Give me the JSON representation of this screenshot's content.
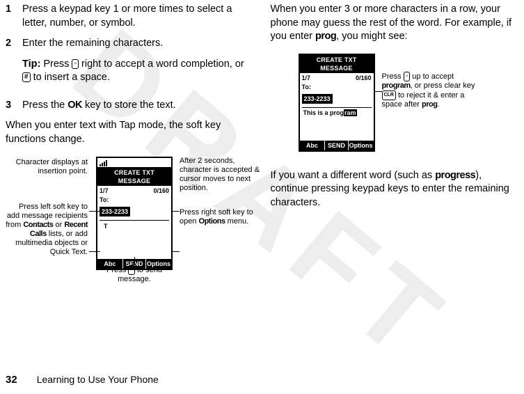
{
  "watermark": "DRAFT",
  "left_column": {
    "steps": [
      {
        "num": "1",
        "body": "Press a keypad key 1 or more times to select a letter, number, or symbol."
      },
      {
        "num": "2",
        "body": "Enter the remaining characters."
      },
      {
        "num": "3",
        "body_prefix": "Press the ",
        "body_key": "OK",
        "body_suffix": " key to store the text."
      }
    ],
    "tip_label": "Tip:",
    "tip_prefix": " Press ",
    "tip_mid": " right to accept a word completion, or ",
    "tip_hash": "#",
    "tip_suffix": " to insert a space.",
    "soft_key_para": "When you enter text with Tap mode, the soft key functions change."
  },
  "diagram1": {
    "title": "CREATE TXT MESSAGE",
    "page": "1/7",
    "count": "0/160",
    "to": "To:",
    "number": "233-2233",
    "text_char": "T",
    "soft_left": "Abc",
    "soft_mid": "SEND",
    "soft_right": "Options",
    "callouts": {
      "cl_char": "Character displays at insertion point.",
      "cl_leftsoft_a": "Press left soft key to add message recipients from ",
      "cl_leftsoft_kw1": "Contacts",
      "cl_leftsoft_b": " or ",
      "cl_leftsoft_kw2": "Recent Calls",
      "cl_leftsoft_c": " lists, or add multimedia objects or Quick Text.",
      "cl_send_a": "Press ",
      "cl_send_b": " to send message.",
      "cl_after2": "After 2 seconds, character is accepted & cursor moves to next position.",
      "cl_rightsoft_a": "Press right soft key to open ",
      "cl_rightsoft_kw": "Options",
      "cl_rightsoft_b": " menu."
    }
  },
  "right_column": {
    "intro_a": "When you enter 3 or more characters in a row, your phone may guess the rest of the word. For example, if you enter ",
    "intro_kw": "prog",
    "intro_b": ", you might see:",
    "outro_a": "If you want a different word (such as ",
    "outro_kw": "progress",
    "outro_b": "), continue pressing keypad keys to enter the remaining characters."
  },
  "diagram2": {
    "title": "CREATE TXT MESSAGE",
    "page": "1/7",
    "count": "0/160",
    "to": "To:",
    "number": "233-2233",
    "text_prefix": "This is a prog",
    "text_suffix": "ram",
    "soft_left": "Abc",
    "soft_mid": "SEND",
    "soft_right": "Options",
    "callout_a": "Press ",
    "callout_b": " up to accept ",
    "callout_kw": "program",
    "callout_c": ", or press clear key ",
    "callout_clr": "CLR",
    "callout_d": " to reject it & enter a space after ",
    "callout_kw2": "prog",
    "callout_e": "."
  },
  "footer": {
    "page": "32",
    "title": "Learning to Use Your Phone"
  }
}
